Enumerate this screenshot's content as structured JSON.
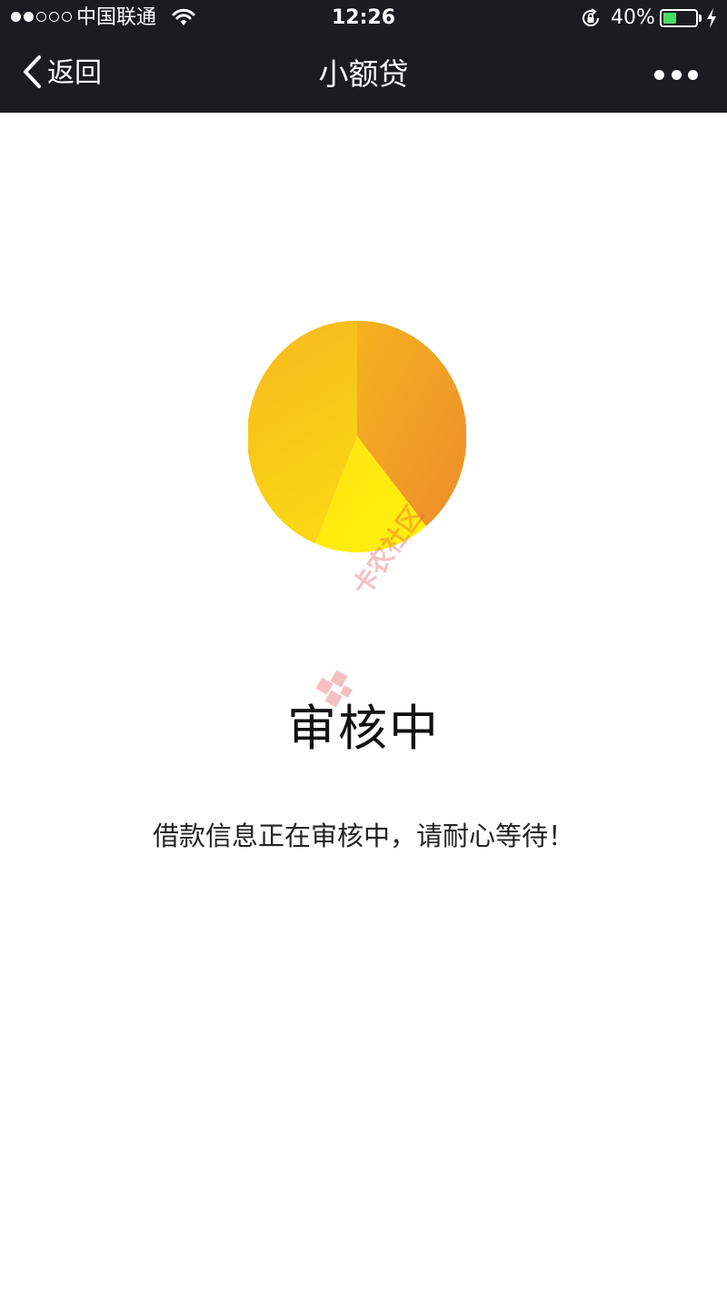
{
  "status_bar": {
    "signal_strength": 2,
    "signal_max": 5,
    "carrier": "中国联通",
    "wifi_icon": "wifi-icon",
    "time": "12:26",
    "rotation_lock_icon": "rotation-lock-icon",
    "battery_percent_label": "40%",
    "battery_level": 0.4,
    "battery_fill_color": "#4cd964",
    "charging_icon": "charging-bolt-icon"
  },
  "nav": {
    "back_label": "返回",
    "back_icon": "chevron-left-icon",
    "title": "小额贷",
    "more_icon": "more-dots-icon",
    "background": "#1c1b20"
  },
  "review": {
    "illustration": "pie-progress-icon",
    "illustration_colors": {
      "yellow_light": "#f8c21c",
      "yellow_bright": "#ffe80a",
      "orange": "#f0902a"
    },
    "title": "审核中",
    "message": "借款信息正在审核中，请耐心等待！"
  },
  "watermark": {
    "text": "卡农社区",
    "color": "#e8494f"
  }
}
